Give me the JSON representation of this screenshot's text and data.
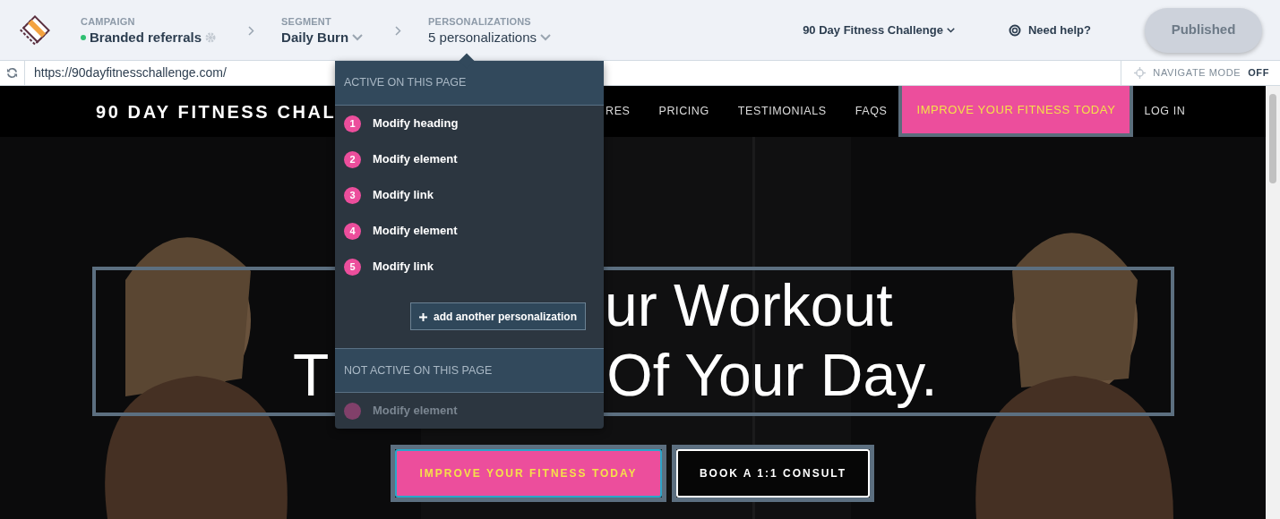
{
  "breadcrumb": [
    {
      "label": "CAMPAIGN",
      "value": "Branded referrals",
      "kind": "campaign",
      "live": true
    },
    {
      "label": "SEGMENT",
      "value": "Daily Burn",
      "kind": "select",
      "live": false
    },
    {
      "label": "PERSONALIZATIONS",
      "value": "5 personalizations",
      "kind": "count",
      "live": false
    }
  ],
  "site_selector": "90 Day Fitness Challenge",
  "help": "Need help?",
  "publish_button": {
    "label": "Published",
    "disabled": true
  },
  "url": "https://90dayfitnesschallenge.com/",
  "navigate_mode": {
    "label": "NAVIGATE MODE",
    "value": "OFF"
  },
  "site": {
    "brand": "90 DAY FITNESS CHAL",
    "nav": [
      {
        "label": "RES",
        "kind": "link"
      },
      {
        "label": "PRICING",
        "kind": "link"
      },
      {
        "label": "TESTIMONIALS",
        "kind": "link"
      },
      {
        "label": "FAQS",
        "kind": "link"
      },
      {
        "label": "IMPROVE YOUR FITNESS TODAY",
        "kind": "cta"
      },
      {
        "label": "LOG IN",
        "kind": "link"
      }
    ],
    "heading_lines": [
      [
        "ur Workout"
      ],
      [
        "T",
        "Of Your Day."
      ]
    ],
    "buttons": [
      {
        "label": "IMPROVE YOUR FITNESS TODAY",
        "kind": "primary"
      },
      {
        "label": "BOOK A 1:1 CONSULT",
        "kind": "outline"
      }
    ]
  },
  "menu": {
    "active_heading": "ACTIVE ON THIS PAGE",
    "items": [
      {
        "number": "1",
        "label": "Modify heading",
        "active": true
      },
      {
        "number": "2",
        "label": "Modify element",
        "active": true
      },
      {
        "number": "3",
        "label": "Modify link",
        "active": true
      },
      {
        "number": "4",
        "label": "Modify element",
        "active": true
      },
      {
        "number": "5",
        "label": "Modify link",
        "active": true
      }
    ],
    "add_button": "add another personalization",
    "inactive_heading": "NOT ACTIVE ON THIS PAGE",
    "inactive_items": [
      {
        "label": "Modify element",
        "active": false
      }
    ]
  }
}
